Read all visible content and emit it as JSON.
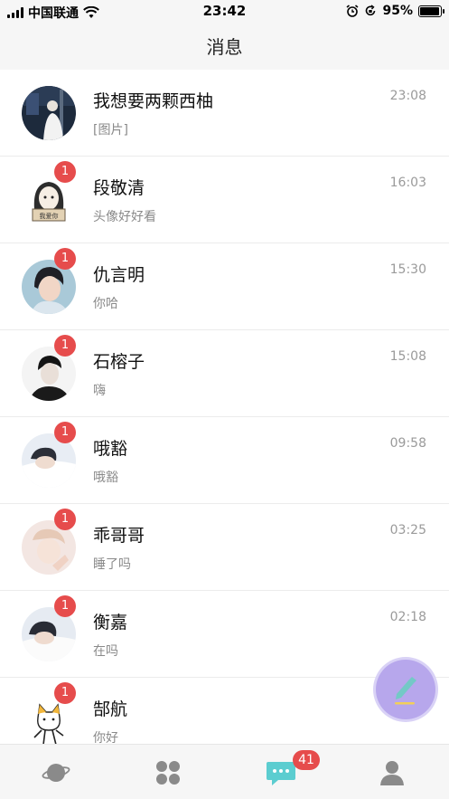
{
  "status_bar": {
    "carrier": "中国联通",
    "time": "23:42",
    "battery_percent": "95%",
    "battery_level": 0.95
  },
  "header": {
    "title": "消息"
  },
  "conversations": [
    {
      "name": "我想要两颗西柚",
      "preview": "[图片]",
      "time": "23:08",
      "unread": ""
    },
    {
      "name": "段敬清",
      "preview": "头像好好看",
      "time": "16:03",
      "unread": "1"
    },
    {
      "name": "仇言明",
      "preview": "你哈",
      "time": "15:30",
      "unread": "1"
    },
    {
      "name": "石榕子",
      "preview": "嗨",
      "time": "15:08",
      "unread": "1"
    },
    {
      "name": "哦豁",
      "preview": "哦豁",
      "time": "09:58",
      "unread": "1"
    },
    {
      "name": "乖哥哥",
      "preview": "睡了吗",
      "time": "03:25",
      "unread": "1"
    },
    {
      "name": "衡嘉",
      "preview": "在吗",
      "time": "02:18",
      "unread": "1"
    },
    {
      "name": "郜航",
      "preview": "你好",
      "time": "",
      "unread": "1"
    }
  ],
  "tab_bar": {
    "tabs": [
      {
        "icon": "planet-icon",
        "active": false
      },
      {
        "icon": "apps-grid-icon",
        "active": false
      },
      {
        "icon": "chat-bubble-icon",
        "active": true
      },
      {
        "icon": "user-profile-icon",
        "active": false
      }
    ],
    "messages_badge": "41"
  },
  "fab": {
    "icon": "compose-pen-icon"
  },
  "colors": {
    "accent_teal": "#5ccdd0",
    "badge_red": "#e64c4c",
    "fab_purple": "#b7a7ec"
  }
}
